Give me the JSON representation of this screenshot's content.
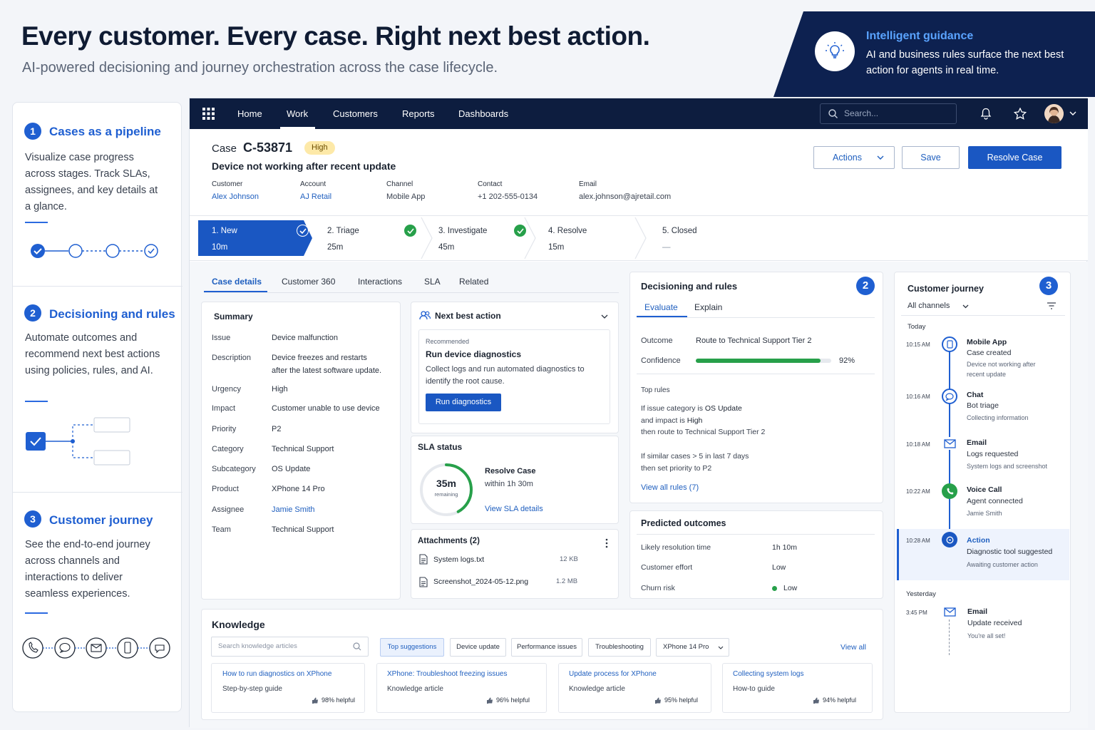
{
  "hero": {
    "title": "Every customer. Every case. Right next best action.",
    "subtitle": "AI-powered decisioning and journey orchestration across the case lifecycle."
  },
  "guidance": {
    "title": "Intelligent guidance",
    "text": "AI and business rules surface the next best action for agents in real time."
  },
  "features": [
    {
      "num": "1",
      "title": "Cases as a pipeline",
      "desc": "Visualize case progress across stages. Track SLAs, assignees, and key details at a glance."
    },
    {
      "num": "2",
      "title": "Decisioning and rules",
      "desc": "Automate outcomes and recommend next best actions using policies, rules, and AI."
    },
    {
      "num": "3",
      "title": "Customer journey",
      "desc": "See the end-to-end journey across channels and interactions to deliver seamless experiences."
    }
  ],
  "nav": {
    "items": [
      "Home",
      "Work",
      "Customers",
      "Reports",
      "Dashboards"
    ],
    "active": "Work",
    "search_placeholder": "Search..."
  },
  "case": {
    "label": "Case",
    "id": "C-53871",
    "priority_badge": "High",
    "title": "Device not working after recent update",
    "fields": [
      {
        "label": "Customer",
        "value": "Alex Johnson",
        "link": true
      },
      {
        "label": "Account",
        "value": "AJ Retail",
        "link": true
      },
      {
        "label": "Channel",
        "value": "Mobile App",
        "link": false
      },
      {
        "label": "Contact",
        "value": "+1 202-555-0134",
        "link": false
      },
      {
        "label": "Email",
        "value": "alex.johnson@ajretail.com",
        "link": false
      }
    ],
    "buttons": {
      "actions": "Actions",
      "save": "Save",
      "resolve": "Resolve Case"
    }
  },
  "stages": [
    {
      "name": "1. New",
      "time": "10m",
      "done": true,
      "active": true
    },
    {
      "name": "2. Triage",
      "time": "25m",
      "done": true,
      "active": false
    },
    {
      "name": "3. Investigate",
      "time": "45m",
      "done": true,
      "active": false
    },
    {
      "name": "4. Resolve",
      "time": "15m",
      "done": false,
      "active": false
    },
    {
      "name": "5. Closed",
      "time": "—",
      "done": false,
      "active": false
    }
  ],
  "tabs": [
    "Case details",
    "Customer 360",
    "Interactions",
    "SLA",
    "Related"
  ],
  "summary": {
    "title": "Summary",
    "rows": [
      {
        "label": "Issue",
        "value": "Device malfunction"
      },
      {
        "label": "Description",
        "value": "Device freezes and restarts",
        "value2": "after the latest software update."
      },
      {
        "label": "Urgency",
        "value": "High"
      },
      {
        "label": "Impact",
        "value": "Customer unable to use device"
      },
      {
        "label": "Priority",
        "value": "P2"
      },
      {
        "label": "Category",
        "value": "Technical Support"
      },
      {
        "label": "Subcategory",
        "value": "OS Update"
      },
      {
        "label": "Product",
        "value": "XPhone 14 Pro"
      },
      {
        "label": "Assignee",
        "value": "Jamie Smith",
        "link": true
      },
      {
        "label": "Team",
        "value": "Technical Support"
      }
    ]
  },
  "nba": {
    "title": "Next best action",
    "tag": "Recommended",
    "action_title": "Run device diagnostics",
    "action_desc": "Collect logs and run automated diagnostics to identify the root cause.",
    "button": "Run diagnostics"
  },
  "sla": {
    "title": "SLA status",
    "remaining_value": "35m",
    "remaining_label": "remaining",
    "remaining_fraction": 0.42,
    "target_title": "Resolve Case",
    "target_within": "within 1h 30m",
    "link": "View SLA details"
  },
  "attachments": {
    "title": "Attachments (2)",
    "files": [
      {
        "name": "System logs.txt",
        "size": "12 KB"
      },
      {
        "name": "Screenshot_2024-05-12.png",
        "size": "1.2 MB"
      }
    ]
  },
  "decisioning": {
    "badge": "2",
    "title": "Decisioning and rules",
    "tabs": [
      "Evaluate",
      "Explain"
    ],
    "outcome_label": "Outcome",
    "outcome_value": "Route to Technical Support Tier 2",
    "confidence_label": "Confidence",
    "confidence_value": "92%",
    "confidence_fraction": 0.92,
    "top_rules_label": "Top rules",
    "rule1": {
      "l1a": "If issue category is ",
      "l1b": "OS Update",
      "l2a": "and impact is ",
      "l2b": "High",
      "l3": "then route to Technical Support Tier 2"
    },
    "rule2": {
      "l1": "If similar cases > 5 in last 7 days",
      "l2": "then set priority to P2"
    },
    "link": "View all rules (7)"
  },
  "predicted": {
    "title": "Predicted outcomes",
    "rows": [
      {
        "label": "Likely resolution time",
        "value": "1h 10m"
      },
      {
        "label": "Customer effort",
        "value": "Low"
      },
      {
        "label": "Churn risk",
        "value": "Low"
      }
    ]
  },
  "journey": {
    "badge": "3",
    "title": "Customer journey",
    "filter": "All channels",
    "today": "Today",
    "yesterday": "Yesterday",
    "events": [
      {
        "time": "10:15 AM",
        "channel": "Mobile App",
        "line2": "Case created",
        "line3a": "Device not working after",
        "line3b": "recent update",
        "icon": "mobile-icon"
      },
      {
        "time": "10:16 AM",
        "channel": "Chat",
        "line2": "Bot triage",
        "line3a": "Collecting information",
        "line3b": "",
        "icon": "chat-icon"
      },
      {
        "time": "10:18 AM",
        "channel": "Email",
        "line2": "Logs requested",
        "line3a": "System logs and screenshot",
        "line3b": "",
        "icon": "email-icon"
      },
      {
        "time": "10:22 AM",
        "channel": "Voice Call",
        "line2": "Agent connected",
        "line3a": "Jamie Smith",
        "line3b": "",
        "icon": "phone-icon"
      },
      {
        "time": "10:28 AM",
        "channel": "Action",
        "line2": "Diagnostic tool suggested",
        "line3a": "Awaiting customer action",
        "line3b": "",
        "icon": "action-icon"
      },
      {
        "time": "3:45 PM",
        "channel": "Email",
        "line2": "Update received",
        "line3a": "You're all set!",
        "line3b": "",
        "icon": "email-icon"
      }
    ]
  },
  "knowledge": {
    "title": "Knowledge",
    "search_placeholder": "Search knowledge articles",
    "chips": [
      "Top suggestions",
      "Device update",
      "Performance issues",
      "Troubleshooting",
      "XPhone 14 Pro"
    ],
    "view_all": "View all",
    "articles": [
      {
        "title": "How to run diagnostics on XPhone",
        "type": "Step-by-step guide",
        "helpful": "98% helpful"
      },
      {
        "title": "XPhone: Troubleshoot freezing issues",
        "type": "Knowledge article",
        "helpful": "96% helpful"
      },
      {
        "title": "Update process for XPhone",
        "type": "Knowledge article",
        "helpful": "95% helpful"
      },
      {
        "title": "Collecting system logs",
        "type": "How-to guide",
        "helpful": "94% helpful"
      }
    ]
  },
  "colors": {
    "brand": "#1f5fd1",
    "navy": "#0d1d3f",
    "success": "#27a04a",
    "badge_bg": "#fde9a8"
  }
}
